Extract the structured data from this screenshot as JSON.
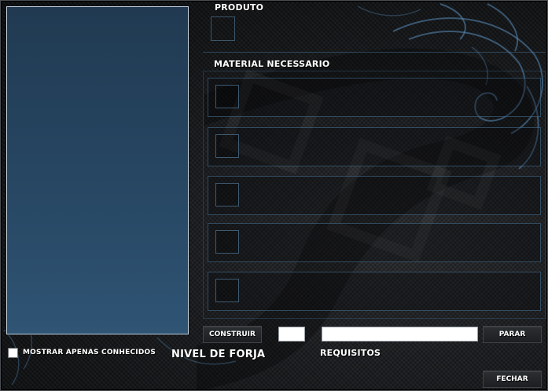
{
  "window": {
    "product_label": "PRODUTO",
    "materials_label": "MATERIAL NECESSARIO",
    "show_known_label": "MOSTRAR APENAS CONHECIDOS",
    "forge_level_label": "NIVEL DE FORJA",
    "requirements_label": "REQUISITOS"
  },
  "controls": {
    "build_button": "CONSTRUIR",
    "stop_button": "PARAR",
    "close_button": "FECHAR",
    "quantity_value": "",
    "requirements_value": "",
    "show_known_checked": false
  },
  "materials": [
    {
      "slot": 1
    },
    {
      "slot": 2
    },
    {
      "slot": 3
    },
    {
      "slot": 4
    },
    {
      "slot": 5
    }
  ],
  "colors": {
    "accent_blue": "#2f5474",
    "frame_blue": "#4b789b",
    "background": "#121416"
  },
  "icons": [
    "tribal-ornament-icon",
    "checkbox-icon"
  ]
}
